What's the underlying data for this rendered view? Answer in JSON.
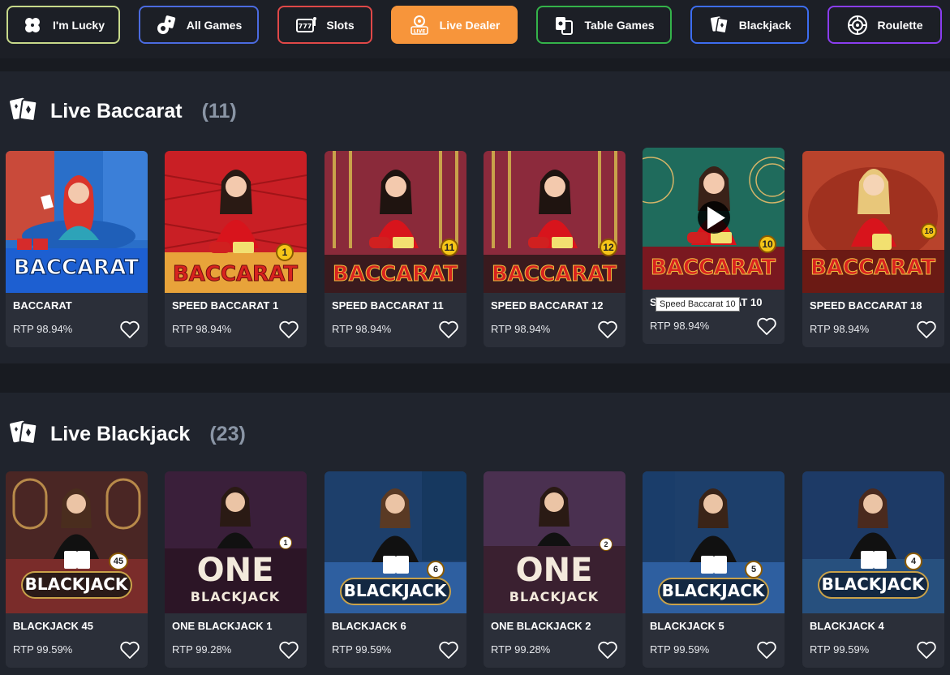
{
  "categories": [
    {
      "label": "I'm Lucky",
      "icon": "clover-icon",
      "color": "#c7d98a",
      "active": false
    },
    {
      "label": "All Games",
      "icon": "dice-cards-icon",
      "color": "#4b6be0",
      "active": false
    },
    {
      "label": "Slots",
      "icon": "slot-machine-icon",
      "color": "#e04848",
      "active": false
    },
    {
      "label": "Live Dealer",
      "icon": "live-icon",
      "color": "#f7953b",
      "active": true
    },
    {
      "label": "Table Games",
      "icon": "table-games-icon",
      "color": "#34b34a",
      "active": false
    },
    {
      "label": "Blackjack",
      "icon": "cards-icon",
      "color": "#3d6df0",
      "active": false
    },
    {
      "label": "Roulette",
      "icon": "roulette-icon",
      "color": "#8a3df0",
      "active": false
    }
  ],
  "sections": [
    {
      "title": "Live Baccarat",
      "count": "(11)",
      "games": [
        {
          "name": "BACCARAT",
          "rtp": "RTP 98.94%",
          "logo": "BACCARAT",
          "badge": ""
        },
        {
          "name": "SPEED BACCARAT 1",
          "rtp": "RTP 98.94%",
          "logo": "BACCARAT",
          "badge": "1"
        },
        {
          "name": "SPEED BACCARAT 11",
          "rtp": "RTP 98.94%",
          "logo": "BACCARAT",
          "badge": "11"
        },
        {
          "name": "SPEED BACCARAT 12",
          "rtp": "RTP 98.94%",
          "logo": "BACCARAT",
          "badge": "12"
        },
        {
          "name": "SPEED BACCARAT 10",
          "rtp": "RTP 98.94%",
          "logo": "BACCARAT",
          "badge": "10"
        },
        {
          "name": "SPEED BACCARAT 18",
          "rtp": "RTP 98.94%",
          "logo": "BACCARAT",
          "badge": "18"
        }
      ]
    },
    {
      "title": "Live Blackjack",
      "count": "(23)",
      "games": [
        {
          "name": "BLACKJACK 45",
          "rtp": "RTP 99.59%",
          "logo": "BLACKJACK",
          "badge": "45"
        },
        {
          "name": "ONE BLACKJACK 1",
          "rtp": "RTP 99.28%",
          "logo": "ONE",
          "badge": "1"
        },
        {
          "name": "BLACKJACK 6",
          "rtp": "RTP 99.59%",
          "logo": "BLACKJACK",
          "badge": "6"
        },
        {
          "name": "ONE BLACKJACK 2",
          "rtp": "RTP 99.28%",
          "logo": "ONE",
          "badge": "2"
        },
        {
          "name": "BLACKJACK 5",
          "rtp": "RTP 99.59%",
          "logo": "BLACKJACK",
          "badge": "5"
        },
        {
          "name": "BLACKJACK 4",
          "rtp": "RTP 99.59%",
          "logo": "BLACKJACK",
          "badge": "4"
        }
      ]
    }
  ],
  "tooltip": "Speed Baccarat 10",
  "colors": {
    "background": "#1c1f26",
    "section": "#20242d",
    "card": "#2b2f39",
    "accent": "#f7953b",
    "count": "#8a95a5"
  }
}
